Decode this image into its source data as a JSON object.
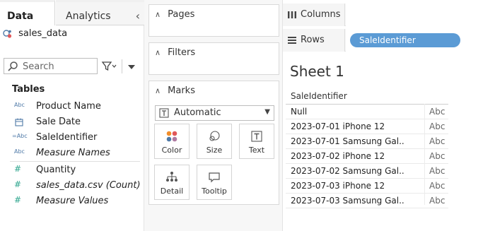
{
  "tabs": {
    "data": "Data",
    "analytics": "Analytics"
  },
  "datasource": {
    "name": "sales_data"
  },
  "search": {
    "placeholder": "Search"
  },
  "tables_heading": "Tables",
  "fields": [
    {
      "type": "Abc",
      "name": "Product Name"
    },
    {
      "type": "calendar",
      "name": "Sale Date"
    },
    {
      "type": "=Abc",
      "name": "SaleIdentifier"
    },
    {
      "type": "Abc",
      "name": "Measure Names"
    },
    {
      "type": "#",
      "name": "Quantity"
    },
    {
      "type": "#",
      "name": "sales_data.csv (Count)"
    },
    {
      "type": "#",
      "name": "Measure Values"
    }
  ],
  "cards": {
    "pages": "Pages",
    "filters": "Filters",
    "marks": "Marks",
    "marks_type": "Automatic"
  },
  "mark_buttons": {
    "color": "Color",
    "size": "Size",
    "text": "Text",
    "detail": "Detail",
    "tooltip": "Tooltip"
  },
  "shelves": {
    "columns": "Columns",
    "rows": "Rows",
    "rows_pill": "SaleIdentifier"
  },
  "sheet": {
    "title": "Sheet 1",
    "column_header": "SaleIdentifier",
    "rows": [
      {
        "label": "Null",
        "value": "Abc"
      },
      {
        "label": "2023-07-01 iPhone 12",
        "value": "Abc"
      },
      {
        "label": "2023-07-01 Samsung Gal..",
        "value": "Abc"
      },
      {
        "label": "2023-07-02 iPhone 12",
        "value": "Abc"
      },
      {
        "label": "2023-07-02 Samsung Gal..",
        "value": "Abc"
      },
      {
        "label": "2023-07-03 iPhone 12",
        "value": "Abc"
      },
      {
        "label": "2023-07-03 Samsung Gal..",
        "value": "Abc"
      }
    ]
  },
  "colors": {
    "pill": "#5b9bd5",
    "field_icon": "#4e79a7",
    "measure_icon": "#2ca58d"
  }
}
